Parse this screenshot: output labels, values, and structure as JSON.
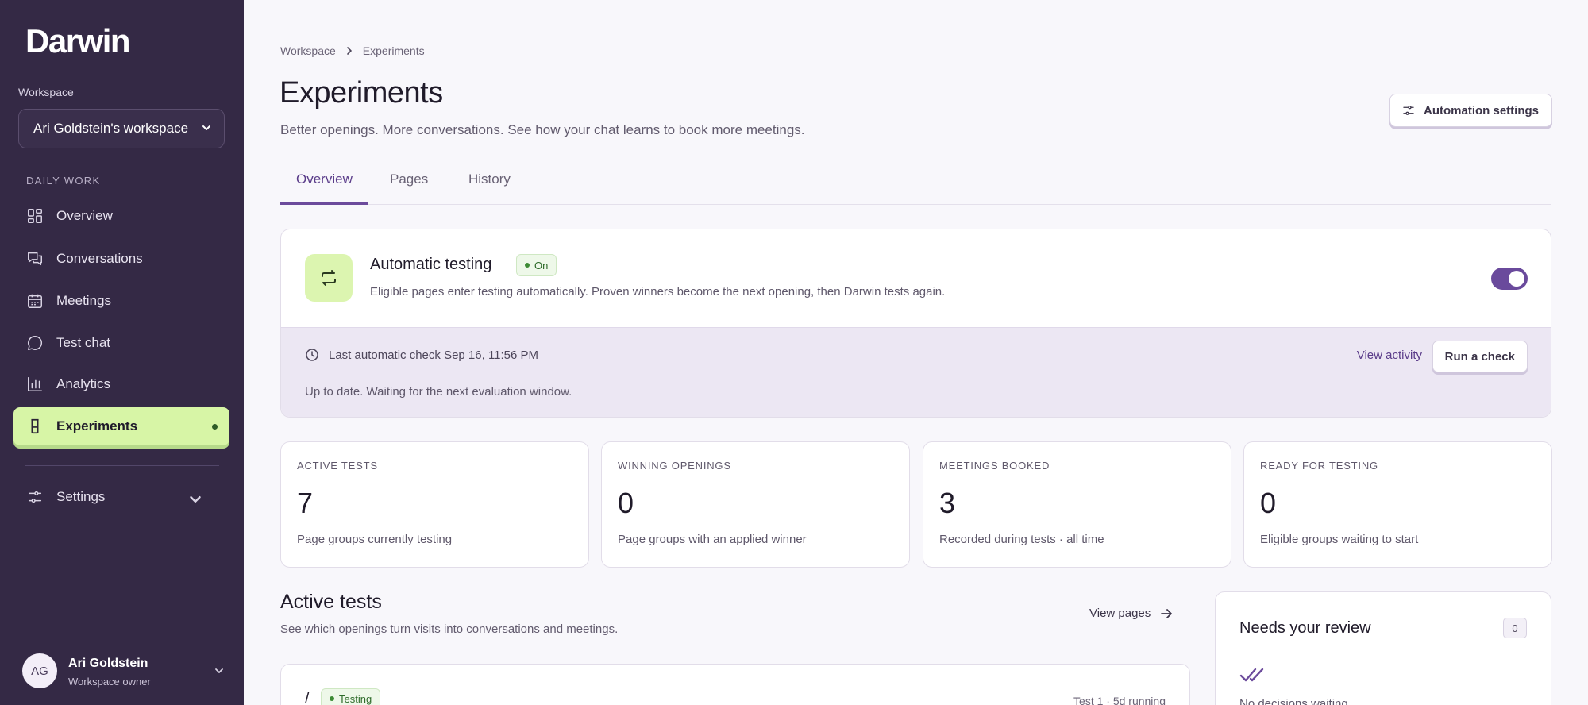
{
  "app": {
    "logo": "Darwin"
  },
  "sidebar": {
    "workspace_label": "Workspace",
    "workspace_value": "Ari Goldstein's workspace",
    "section_label": "DAILY WORK",
    "items": [
      {
        "label": "Overview",
        "icon": "grid-icon"
      },
      {
        "label": "Conversations",
        "icon": "chat-bubbles-icon"
      },
      {
        "label": "Meetings",
        "icon": "calendar-icon"
      },
      {
        "label": "Test chat",
        "icon": "chat-bubble-icon"
      },
      {
        "label": "Analytics",
        "icon": "bar-chart-icon"
      },
      {
        "label": "Experiments",
        "icon": "flask-icon",
        "active": true
      }
    ],
    "settings_label": "Settings",
    "user": {
      "initials": "AG",
      "name": "Ari Goldstein",
      "role": "Workspace owner"
    }
  },
  "breadcrumb": [
    "Workspace",
    "Experiments"
  ],
  "header": {
    "title": "Experiments",
    "subtitle": "Better openings. More conversations. See how your chat learns to book more meetings.",
    "automation_button": "Automation settings"
  },
  "tabs": [
    {
      "label": "Overview",
      "active": true
    },
    {
      "label": "Pages"
    },
    {
      "label": "History"
    }
  ],
  "automatic_testing": {
    "title": "Automatic testing",
    "badge": "On",
    "description": "Eligible pages enter testing automatically. Proven winners become the next opening, then Darwin tests again.",
    "enabled": true,
    "last_check": "Last automatic check Sep 16, 11:56 PM",
    "status": "Up to date. Waiting for the next evaluation window.",
    "view_activity": "View activity",
    "run_check": "Run a check"
  },
  "stats": [
    {
      "label": "ACTIVE TESTS",
      "value": "7",
      "desc": "Page groups currently testing"
    },
    {
      "label": "WINNING OPENINGS",
      "value": "0",
      "desc": "Page groups with an applied winner"
    },
    {
      "label": "MEETINGS BOOKED",
      "value": "3",
      "desc": "Recorded during tests · all time"
    },
    {
      "label": "READY FOR TESTING",
      "value": "0",
      "desc": "Eligible groups waiting to start"
    }
  ],
  "active_tests": {
    "title": "Active tests",
    "subtitle": "See which openings turn visits into conversations and meetings.",
    "view_pages": "View pages",
    "first": {
      "path": "/",
      "badge": "Testing",
      "meta": "Test 1 · 5d running"
    }
  },
  "review": {
    "title": "Needs your review",
    "count": "0",
    "empty": "No decisions waiting"
  },
  "colors": {
    "sidebar": "#342945",
    "accent": "#6c4b9c",
    "active_nav": "#d7f5a6"
  }
}
